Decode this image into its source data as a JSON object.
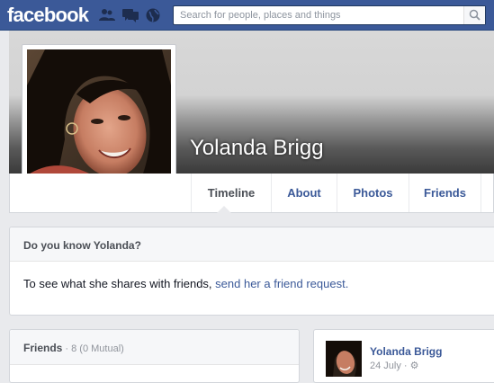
{
  "header": {
    "logo": "facebook",
    "search_placeholder": "Search for people, places and things"
  },
  "profile": {
    "name": "Yolanda Brigg"
  },
  "tabs": [
    {
      "label": "Timeline",
      "active": true
    },
    {
      "label": "About"
    },
    {
      "label": "Photos"
    },
    {
      "label": "Friends"
    }
  ],
  "know_card": {
    "title": "Do you know Yolanda?",
    "text": "To see what she shares with friends, ",
    "link": "send her a friend request."
  },
  "friends_card": {
    "title": "Friends",
    "count": " · 8 (0 Mutual)"
  },
  "post_card": {
    "name": "Yolanda Brigg",
    "meta": "24 July · "
  },
  "colors": {
    "brand_blue": "#3b5998",
    "page_bg": "#e9eaed"
  }
}
